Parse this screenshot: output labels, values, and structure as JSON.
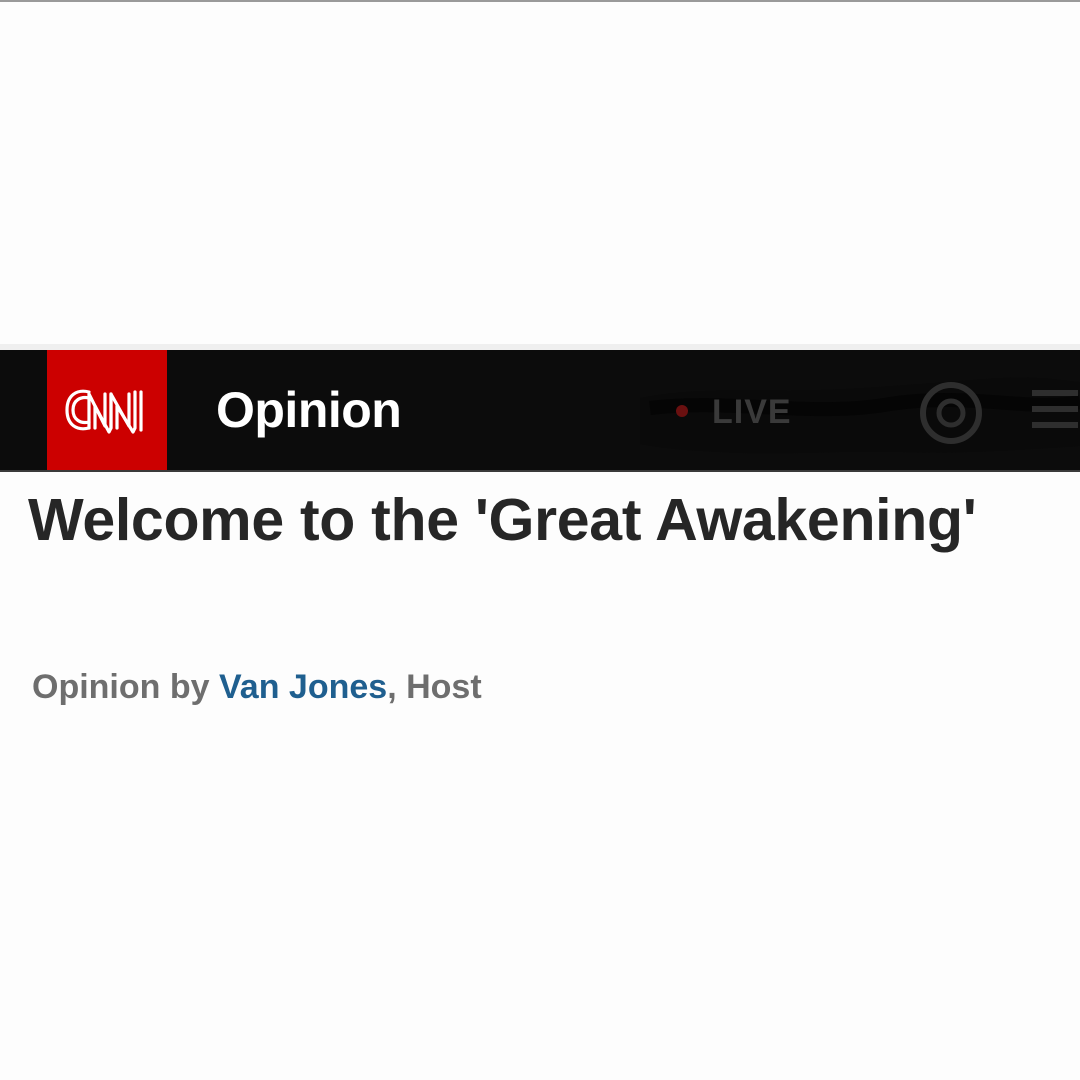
{
  "header": {
    "logo_text": "CNN",
    "section_title": "Opinion",
    "live_label": "LIVE",
    "icons": {
      "search": "search-icon",
      "menu": "menu-icon"
    },
    "colors": {
      "logo_background": "#cc0000",
      "bar_background": "#0c0c0c"
    }
  },
  "article": {
    "headline": "Welcome to the 'Great Awakening'",
    "byline": {
      "prefix": "Opinion by ",
      "author": "Van Jones",
      "separator": ", ",
      "role": "Host"
    },
    "colors": {
      "author_link": "#1f5f8f"
    }
  }
}
